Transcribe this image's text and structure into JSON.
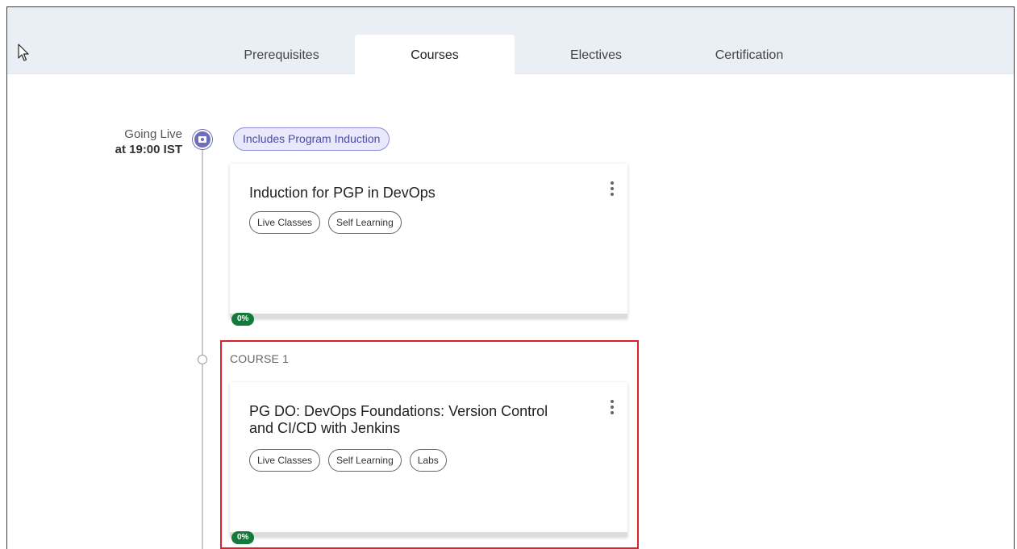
{
  "tabs": [
    {
      "label": "Prerequisites",
      "active": false
    },
    {
      "label": "Courses",
      "active": true
    },
    {
      "label": "Electives",
      "active": false
    },
    {
      "label": "Certification",
      "active": false
    }
  ],
  "timeline": {
    "going_live_label": "Going Live",
    "going_live_time": "at 19:00 IST"
  },
  "induction_pill": "Includes Program Induction",
  "cards": [
    {
      "title": "Induction for PGP in DevOps",
      "tags": [
        "Live Classes",
        "Self Learning"
      ],
      "progress_label": "0%",
      "progress_fraction": 0.0
    },
    {
      "section_label": "COURSE 1",
      "title": "PG DO: DevOps Foundations: Version Control and CI/CD with Jenkins",
      "tags": [
        "Live Classes",
        "Self Learning",
        "Labs"
      ],
      "progress_label": "0%",
      "progress_fraction": 0.0
    }
  ],
  "colors": {
    "tabbar_bg": "#eaeff5",
    "live_icon": "#6d6fb8",
    "progress": "#137a3c",
    "highlight": "#d9232a"
  },
  "icons": [
    "cursor-arrow-icon",
    "live-class-icon",
    "more-vertical-icon"
  ]
}
